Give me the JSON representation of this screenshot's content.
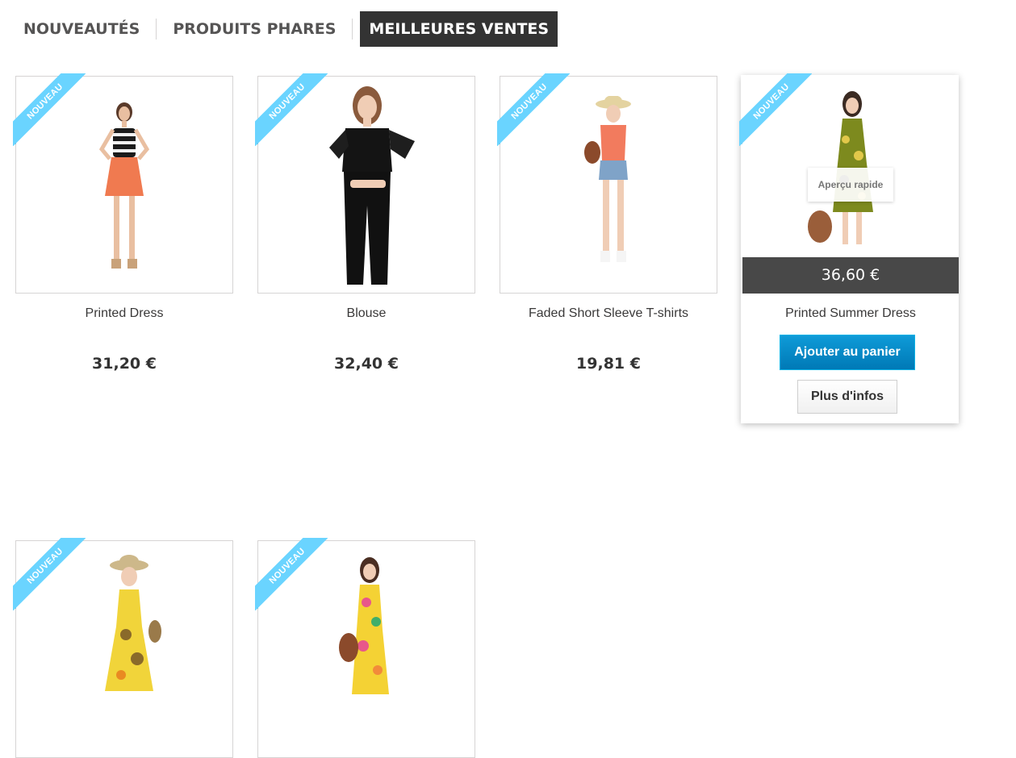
{
  "tabs": [
    {
      "label": "NOUVEAUTÉS",
      "active": false
    },
    {
      "label": "PRODUITS PHARES",
      "active": false
    },
    {
      "label": "MEILLEURES VENTES",
      "active": true
    }
  ],
  "badge_label": "Nouveau",
  "products": [
    {
      "name": "Printed Dress",
      "price": "31,20 €"
    },
    {
      "name": "Blouse",
      "price": "32,40 €"
    },
    {
      "name": "Faded Short Sleeve T-shirts",
      "price": "19,81 €"
    },
    {
      "name": "Printed Summer Dress",
      "price": "36,60 €",
      "quick_view": "Aperçu rapide",
      "add_to_cart": "Ajouter au panier",
      "more_info": "Plus d'infos"
    },
    {
      "name": "",
      "price": ""
    },
    {
      "name": "",
      "price": ""
    }
  ],
  "colors": {
    "ribbon": "#6ad4ff",
    "active_tab": "#333333",
    "cart_button": "#0079b6",
    "price_bar": "#484848"
  }
}
